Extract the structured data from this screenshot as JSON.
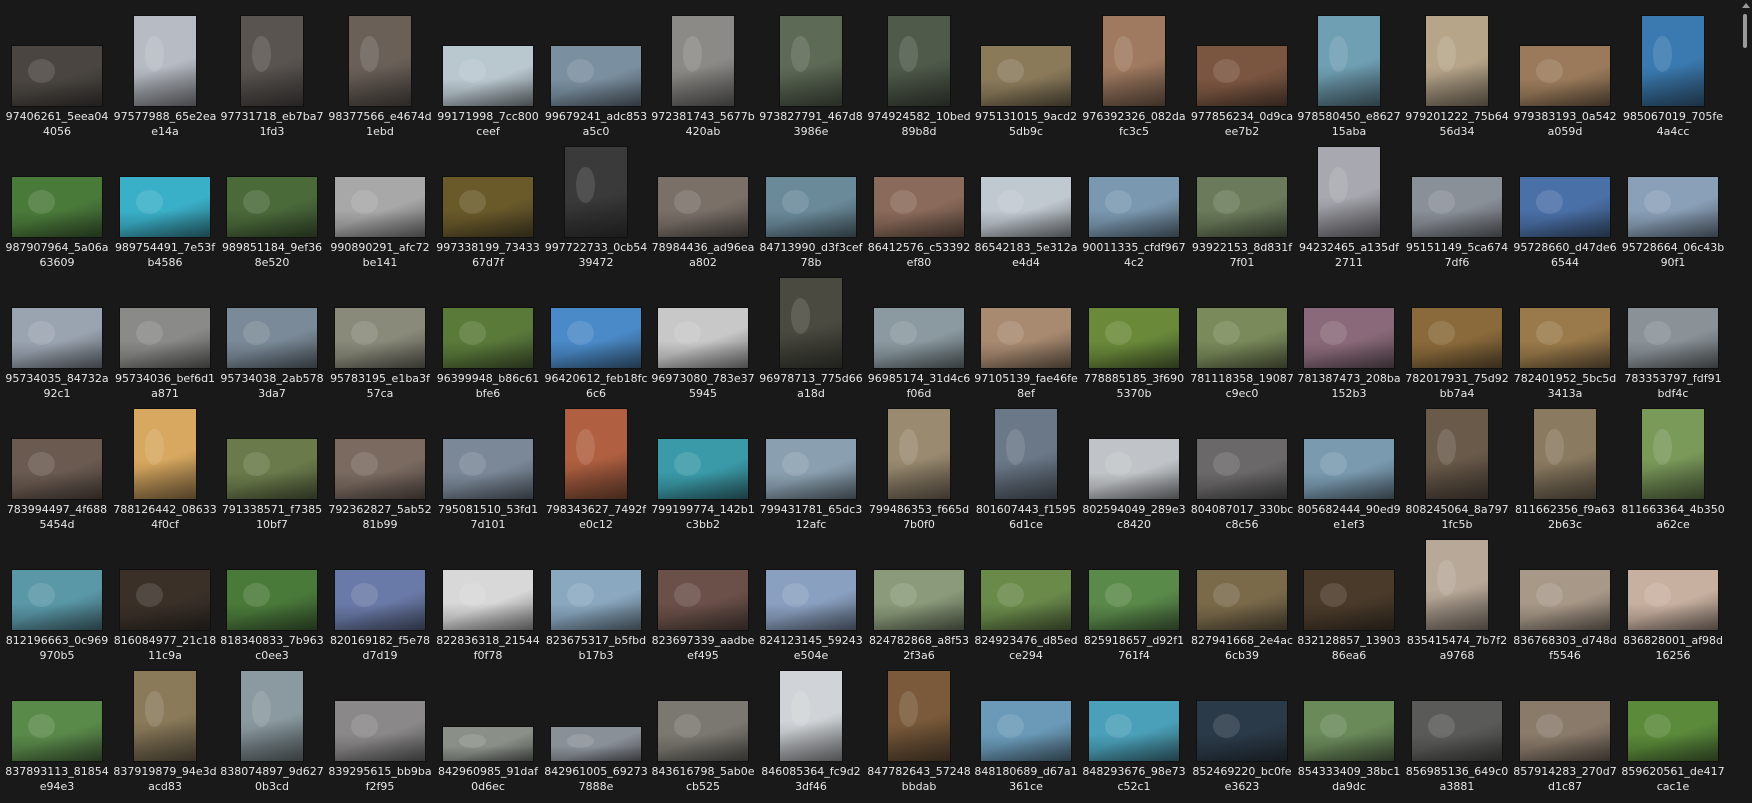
{
  "folder": {
    "items": [
      {
        "name": "97406261_5eea04",
        "name2": "4056",
        "orient": "l",
        "color": "#4a4540"
      },
      {
        "name": "97577988_65e2ea",
        "name2": "e14a",
        "orient": "p",
        "color": "#b7bcc4"
      },
      {
        "name": "97731718_eb7ba7",
        "name2": "1fd3",
        "orient": "p",
        "color": "#5a5450"
      },
      {
        "name": "98377566_e4674d",
        "name2": "1ebd",
        "orient": "p",
        "color": "#6a6058"
      },
      {
        "name": "99171998_7cc800",
        "name2": "ceef",
        "orient": "l",
        "color": "#b9c7cf"
      },
      {
        "name": "99679241_adc853",
        "name2": "a5c0",
        "orient": "l",
        "color": "#7a8fa0"
      },
      {
        "name": "972381743_5677b",
        "name2": "420ab",
        "orient": "p",
        "color": "#8b8a86"
      },
      {
        "name": "973827791_467d8",
        "name2": "3986e",
        "orient": "p",
        "color": "#5d6a55"
      },
      {
        "name": "974924582_10bed",
        "name2": "89b8d",
        "orient": "p",
        "color": "#4f5a4a"
      },
      {
        "name": "975131015_9acd2",
        "name2": "5db9c",
        "orient": "l",
        "color": "#8a7a5a"
      },
      {
        "name": "976392326_082da",
        "name2": "fc3c5",
        "orient": "p",
        "color": "#a07a60"
      },
      {
        "name": "977856234_0d9ca",
        "name2": "ee7b2",
        "orient": "l",
        "color": "#7a5540"
      },
      {
        "name": "978580450_e8627",
        "name2": "15aba",
        "orient": "p",
        "color": "#6f9fb3"
      },
      {
        "name": "979201222_75b64",
        "name2": "56d34",
        "orient": "p",
        "color": "#b7a58a"
      },
      {
        "name": "979383193_0a542",
        "name2": "a059d",
        "orient": "l",
        "color": "#9a7a5a"
      },
      {
        "name": "985067019_705fe",
        "name2": "4a4cc",
        "orient": "p",
        "color": "#3a7ab0"
      },
      {
        "name": "987907964_5a06a",
        "name2": "63609",
        "orient": "l",
        "color": "#4a7a3a"
      },
      {
        "name": "989754491_7e53f",
        "name2": "b4586",
        "orient": "l",
        "color": "#3ab0c8"
      },
      {
        "name": "989851184_9ef36",
        "name2": "8e520",
        "orient": "l",
        "color": "#4a6a3a"
      },
      {
        "name": "990890291_afc72",
        "name2": "be141",
        "orient": "l",
        "color": "#a8a8a8"
      },
      {
        "name": "997338199_73433",
        "name2": "67d7f",
        "orient": "l",
        "color": "#6a5a2a"
      },
      {
        "name": "997722733_0cb54",
        "name2": "39472",
        "orient": "p",
        "color": "#3a3a3a"
      },
      {
        "name": "78984436_ad96ea",
        "name2": "a802",
        "orient": "l",
        "color": "#7a7068"
      },
      {
        "name": "84713990_d3f3cef",
        "name2": "78b",
        "orient": "l",
        "color": "#6a8a9a"
      },
      {
        "name": "86412576_c53392",
        "name2": "ef80",
        "orient": "l",
        "color": "#8a6a5a"
      },
      {
        "name": "86542183_5e312a",
        "name2": "e4d4",
        "orient": "l",
        "color": "#c0c8d0"
      },
      {
        "name": "90011335_cfdf967",
        "name2": "4c2",
        "orient": "l",
        "color": "#7a98b0"
      },
      {
        "name": "93922153_8d831f",
        "name2": "7f01",
        "orient": "l",
        "color": "#6a7a5a"
      },
      {
        "name": "94232465_a135df",
        "name2": "2711",
        "orient": "p",
        "color": "#a8a8b0"
      },
      {
        "name": "95151149_5ca674",
        "name2": "7df6",
        "orient": "l",
        "color": "#8a9098"
      },
      {
        "name": "95728660_d47de6",
        "name2": "6544",
        "orient": "l",
        "color": "#4a70a8"
      },
      {
        "name": "95728664_06c43b",
        "name2": "90f1",
        "orient": "l",
        "color": "#8aa0b8"
      },
      {
        "name": "95734035_84732a",
        "name2": "92c1",
        "orient": "l",
        "color": "#9aa4b0"
      },
      {
        "name": "95734036_bef6d1",
        "name2": "a871",
        "orient": "l",
        "color": "#8a8a88"
      },
      {
        "name": "95734038_2ab578",
        "name2": "3da7",
        "orient": "l",
        "color": "#7a8a98"
      },
      {
        "name": "95783195_e1ba3f",
        "name2": "57ca",
        "orient": "l",
        "color": "#8a8a7a"
      },
      {
        "name": "96399948_b86c61",
        "name2": "bfe6",
        "orient": "l",
        "color": "#5a7a3a"
      },
      {
        "name": "96420612_feb18fc",
        "name2": "6c6",
        "orient": "l",
        "color": "#4a8ac8"
      },
      {
        "name": "96973080_783e37",
        "name2": "5945",
        "orient": "l",
        "color": "#c8c8c8"
      },
      {
        "name": "96978713_775d66",
        "name2": "a18d",
        "orient": "p",
        "color": "#4a4a40"
      },
      {
        "name": "96985174_31d4c6",
        "name2": "f06d",
        "orient": "l",
        "color": "#8a9aa0"
      },
      {
        "name": "97105139_fae46fe",
        "name2": "8ef",
        "orient": "l",
        "color": "#a88a70"
      },
      {
        "name": "778885185_3f690",
        "name2": "5370b",
        "orient": "l",
        "color": "#6a8a3a"
      },
      {
        "name": "781118358_19087",
        "name2": "c9ec0",
        "orient": "l",
        "color": "#7a8a5a"
      },
      {
        "name": "781387473_208ba",
        "name2": "152b3",
        "orient": "l",
        "color": "#8a6a7a"
      },
      {
        "name": "782017931_75d92",
        "name2": "bb7a4",
        "orient": "l",
        "color": "#8a6a3a"
      },
      {
        "name": "782401952_5bc5d",
        "name2": "3413a",
        "orient": "l",
        "color": "#9a7a4a"
      },
      {
        "name": "783353797_fdf91",
        "name2": "bdf4c",
        "orient": "l",
        "color": "#8a9298"
      },
      {
        "name": "783994497_4f688",
        "name2": "5454d",
        "orient": "l",
        "color": "#6a5a50"
      },
      {
        "name": "788126442_08633",
        "name2": "4f0cf",
        "orient": "p",
        "color": "#d8a860"
      },
      {
        "name": "791338571_f7385",
        "name2": "10bf7",
        "orient": "l",
        "color": "#6a7a4a"
      },
      {
        "name": "792362827_5ab52",
        "name2": "81b99",
        "orient": "l",
        "color": "#7a6a60"
      },
      {
        "name": "795081510_53fd1",
        "name2": "7d101",
        "orient": "l",
        "color": "#7a8898"
      },
      {
        "name": "798343627_7492f",
        "name2": "e0c12",
        "orient": "p",
        "color": "#b06040"
      },
      {
        "name": "799199774_142b1",
        "name2": "c3bb2",
        "orient": "l",
        "color": "#3a9aa8"
      },
      {
        "name": "799431781_65dc3",
        "name2": "12afc",
        "orient": "l",
        "color": "#8aa0b0"
      },
      {
        "name": "799486353_f665d",
        "name2": "7b0f0",
        "orient": "p",
        "color": "#9a8a70"
      },
      {
        "name": "801607443_f1595",
        "name2": "6d1ce",
        "orient": "p",
        "color": "#6a7888"
      },
      {
        "name": "802594049_289e3",
        "name2": "c8420",
        "orient": "l",
        "color": "#c0c4c8"
      },
      {
        "name": "804087017_330bc",
        "name2": "c8c56",
        "orient": "l",
        "color": "#6a6868"
      },
      {
        "name": "805682444_90ed9",
        "name2": "e1ef3",
        "orient": "l",
        "color": "#7a9ab0"
      },
      {
        "name": "808245064_8a797",
        "name2": "1fc5b",
        "orient": "p",
        "color": "#6a5a4a"
      },
      {
        "name": "811662356_f9a63",
        "name2": "2b63c",
        "orient": "p",
        "color": "#8a7a60"
      },
      {
        "name": "811663364_4b350",
        "name2": "a62ce",
        "orient": "p",
        "color": "#7a9a5a"
      },
      {
        "name": "812196663_0c969",
        "name2": "970b5",
        "orient": "l",
        "color": "#5a98a8"
      },
      {
        "name": "816084977_21c18",
        "name2": "11c9a",
        "orient": "l",
        "color": "#3a3028"
      },
      {
        "name": "818340833_7b963",
        "name2": "c0ee3",
        "orient": "l",
        "color": "#4a7a3a"
      },
      {
        "name": "820169182_f5e78",
        "name2": "d7d19",
        "orient": "l",
        "color": "#6a7aa8"
      },
      {
        "name": "822836318_21544",
        "name2": "f0f78",
        "orient": "l",
        "color": "#d8d8d8"
      },
      {
        "name": "823675317_b5fbd",
        "name2": "b17b3",
        "orient": "l",
        "color": "#8aa8c0"
      },
      {
        "name": "823697339_aadbe",
        "name2": "ef495",
        "orient": "l",
        "color": "#6a5048"
      },
      {
        "name": "824123145_59243",
        "name2": "e504e",
        "orient": "l",
        "color": "#8aa0c0"
      },
      {
        "name": "824782868_a8f53",
        "name2": "2f3a6",
        "orient": "l",
        "color": "#8a9a7a"
      },
      {
        "name": "824923476_d85ed",
        "name2": "ce294",
        "orient": "l",
        "color": "#6a8a4a"
      },
      {
        "name": "825918657_d92f1",
        "name2": "761f4",
        "orient": "l",
        "color": "#5a8a4a"
      },
      {
        "name": "827941668_2e4ac",
        "name2": "6cb39",
        "orient": "l",
        "color": "#7a6a4a"
      },
      {
        "name": "832128857_13903",
        "name2": "86ea6",
        "orient": "l",
        "color": "#4a3a2a"
      },
      {
        "name": "835415474_7b7f2",
        "name2": "a9768",
        "orient": "p",
        "color": "#b8a898"
      },
      {
        "name": "836768303_d748d",
        "name2": "f5546",
        "orient": "l",
        "color": "#a89888"
      },
      {
        "name": "836828001_af98d",
        "name2": "16256",
        "orient": "l",
        "color": "#c8b0a0"
      },
      {
        "name": "837893113_81854",
        "name2": "e94e3",
        "orient": "l",
        "color": "#5a8a4a"
      },
      {
        "name": "837919879_94e3d",
        "name2": "acd83",
        "orient": "p",
        "color": "#8a7a5a"
      },
      {
        "name": "838074897_9d627",
        "name2": "0b3cd",
        "orient": "p",
        "color": "#8a9aa0"
      },
      {
        "name": "839295615_bb9ba",
        "name2": "f2f95",
        "orient": "l",
        "color": "#8a8888"
      },
      {
        "name": "842960985_91daf",
        "name2": "0d6ec",
        "orient": "w",
        "color": "#8a9088"
      },
      {
        "name": "842961005_69273",
        "name2": "7888e",
        "orient": "w",
        "color": "#8a9098"
      },
      {
        "name": "843616798_5ab0e",
        "name2": "cb525",
        "orient": "l",
        "color": "#7a7870"
      },
      {
        "name": "846085364_fc9d2",
        "name2": "3df46",
        "orient": "p",
        "color": "#d0d4d8"
      },
      {
        "name": "847782643_57248",
        "name2": "bbdab",
        "orient": "p",
        "color": "#7a5a3a"
      },
      {
        "name": "848180689_d67a1",
        "name2": "361ce",
        "orient": "l",
        "color": "#6a9ab8"
      },
      {
        "name": "848293676_98e73",
        "name2": "c52c1",
        "orient": "l",
        "color": "#4aa0b8"
      },
      {
        "name": "852469220_bc0fe",
        "name2": "e3623",
        "orient": "l",
        "color": "#2a3a48"
      },
      {
        "name": "854333409_38bc1",
        "name2": "da9dc",
        "orient": "l",
        "color": "#6a8a5a"
      },
      {
        "name": "856985136_649c0",
        "name2": "a3881",
        "orient": "l",
        "color": "#5a5a58"
      },
      {
        "name": "857914283_270d7",
        "name2": "d1c87",
        "orient": "l",
        "color": "#8a7a6a"
      },
      {
        "name": "859620561_de417",
        "name2": "cac1e",
        "orient": "l",
        "color": "#5a8a3a"
      }
    ]
  }
}
